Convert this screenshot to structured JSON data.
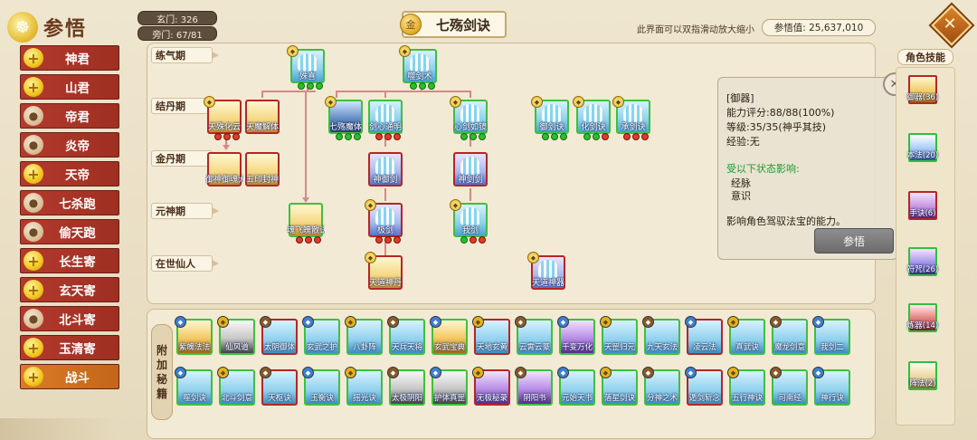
{
  "header": {
    "page_title": "参悟",
    "xuanmen": "玄门: 326",
    "pangmen": "旁门: 67/81",
    "coin_char": "金",
    "tree_title": "七殇剑诀",
    "hint": "此界面可以双指滑动放大缩小",
    "canwu_value": "参悟值: 25,637,010"
  },
  "sidebar": {
    "items": [
      {
        "label": "神君",
        "icon": "plus-icon"
      },
      {
        "label": "山君",
        "icon": "plus-icon"
      },
      {
        "label": "帝君",
        "icon": "person-icon"
      },
      {
        "label": "炎帝",
        "icon": "person-icon"
      },
      {
        "label": "天帝",
        "icon": "plus-icon"
      },
      {
        "label": "七杀跑",
        "icon": "person-icon"
      },
      {
        "label": "偷天跑",
        "icon": "person-icon"
      },
      {
        "label": "长生寄",
        "icon": "plus-icon"
      },
      {
        "label": "玄天寄",
        "icon": "plus-icon"
      },
      {
        "label": "北斗寄",
        "icon": "person-icon"
      },
      {
        "label": "玉清寄",
        "icon": "plus-icon"
      },
      {
        "label": "战斗",
        "icon": "plus-icon",
        "active": true
      }
    ]
  },
  "tree": {
    "realms": [
      "练气期",
      "结丹期",
      "金丹期",
      "元神期",
      "在世仙人"
    ],
    "skills": {
      "s1": "殊喜",
      "s2": "噬剑术",
      "s3": "天殊化云",
      "s4": "天魔解体",
      "s5": "七殇魔体",
      "s6": "剑心通明",
      "s7": "心剑如镜",
      "s8": "御剑诀",
      "s9": "化剑诀",
      "s10": "承剑诀",
      "s11": "御神御魂大法",
      "s12": "五印封神",
      "s13": "神御剑",
      "s14": "神剑剑",
      "s15": "魂飞魄散诀",
      "s16": "极剑",
      "s17": "我剑",
      "s18": "天道神丹",
      "s19": "天道神器"
    }
  },
  "extra": {
    "side_tag": [
      "附",
      "加",
      "秘",
      "籍"
    ],
    "row1": [
      "紫魄法法",
      "仙风道",
      "太阴御体",
      "玄武之护",
      "八卦阵",
      "天兵天将",
      "玄武宝典",
      "天地玄黄",
      "云霄云篆",
      "千变万化",
      "天罡归元",
      "九天玄法",
      "凌云法",
      "真武诀",
      "魔龙剑意",
      "我剑二"
    ],
    "row2": [
      "噬剑诀",
      "北斗剑意",
      "天枢诀",
      "玉衡诀",
      "摇光诀",
      "太极阴阳",
      "护体真罡",
      "无极秘录",
      "阴阳书",
      "元始天书",
      "落星剑诀",
      "分神之术",
      "遁剑斩念",
      "五行神诀",
      "司南经",
      "神行诀"
    ]
  },
  "info": {
    "name": "[御器]",
    "score": "能力评分:88/88(100%)",
    "level": "等级:35/35(神乎其技)",
    "exp": "经验:无",
    "affected_title": "受以下状态影响:",
    "affected_1": "经脉",
    "affected_2": "意识",
    "desc": "影响角色驾驭法宝的能力。",
    "button": "参悟"
  },
  "right": {
    "title": "角色技能",
    "items": [
      "御器(36)",
      "本法(20)",
      "手诀(6)",
      "符咒(26)",
      "炼器(14)",
      "阵法(2)"
    ]
  },
  "colors": {
    "accent_red": "#b33a2d",
    "active_orange": "#d97c24",
    "green_border": "#3fbf3f",
    "red_border": "#b52626"
  }
}
